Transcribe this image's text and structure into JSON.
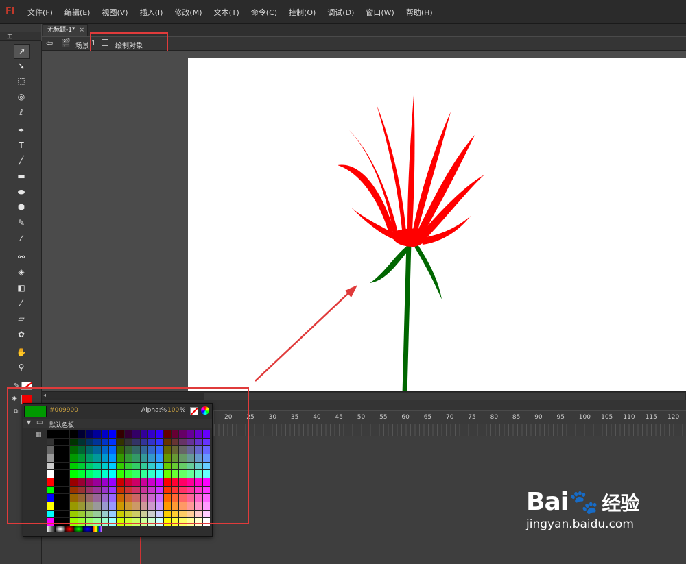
{
  "app": {
    "logo": "Fl"
  },
  "menu": [
    "文件(F)",
    "编辑(E)",
    "视图(V)",
    "插入(I)",
    "修改(M)",
    "文本(T)",
    "命令(C)",
    "控制(O)",
    "调试(D)",
    "窗口(W)",
    "帮助(H)"
  ],
  "tools_panel": {
    "title": "工..."
  },
  "document": {
    "tab_title": "无标题-1*",
    "tab_close": "×"
  },
  "breadcrumb": {
    "scene_label": "场景",
    "scene_number": "1",
    "object_label": "绘制对象"
  },
  "timeline": {
    "frames": [
      "20",
      "25",
      "30",
      "35",
      "40",
      "45",
      "50",
      "55",
      "60",
      "65",
      "70",
      "75",
      "80",
      "85",
      "90",
      "95",
      "100",
      "105",
      "110",
      "115",
      "120"
    ]
  },
  "swatches": {
    "current_hex": "#009900",
    "current_color": "#009900",
    "alpha_label": "Alpha:%",
    "alpha_value": "100",
    "alpha_unit": "%",
    "palette_name": "默认色板"
  },
  "fill_color": "#f00000",
  "stroke_color": "none",
  "artwork": {
    "flower_color": "#ff0000",
    "stem_color": "#006600"
  },
  "watermark": {
    "brand": "Bai",
    "brand_cn": "经验",
    "url": "jingyan.baidu.com"
  }
}
